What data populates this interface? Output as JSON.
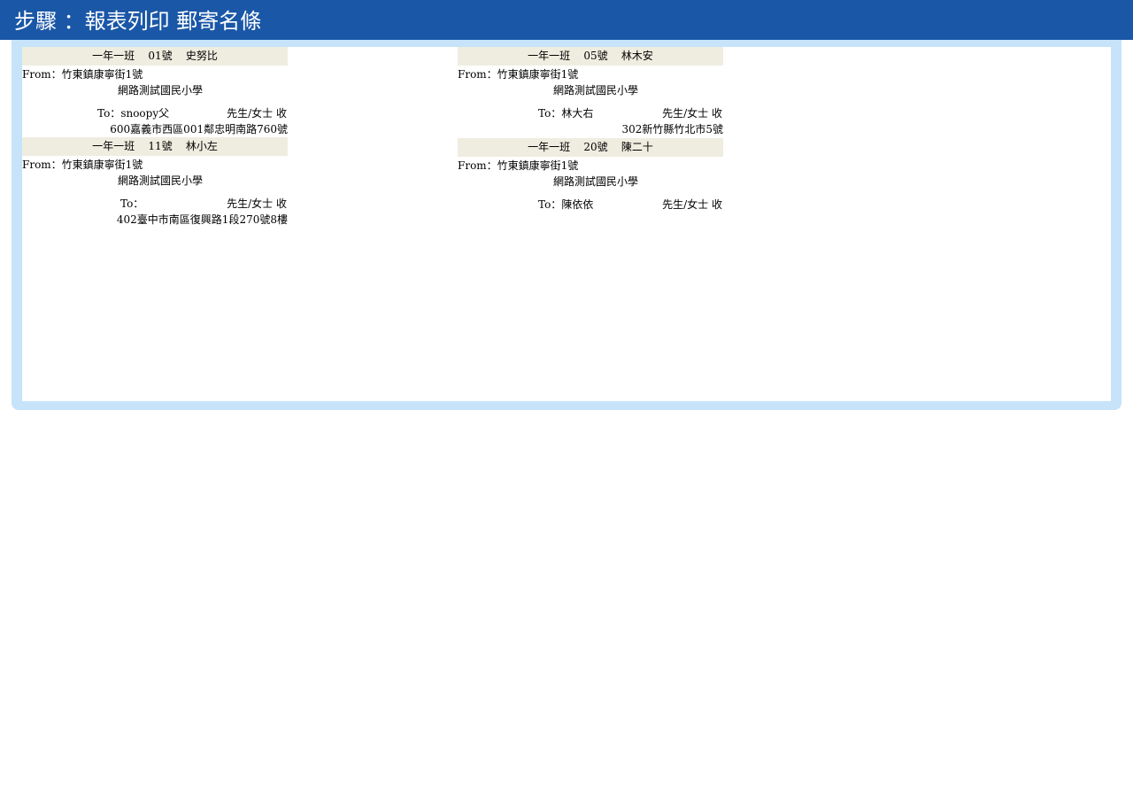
{
  "header": {
    "title": "步驟 ：報表列印  郵寄名條"
  },
  "labels": [
    {
      "class_name": "一年一班",
      "seat": "01號",
      "student": "史努比",
      "from_label": "From：",
      "from_address": "竹東鎮康寧街1號",
      "from_school": "網路測試國民小學",
      "to_label": "To：",
      "to_name": "snoopy父",
      "to_suffix": "先生/女士 收",
      "to_address": "600嘉義市西區001鄰忠明南路760號"
    },
    {
      "class_name": "一年一班",
      "seat": "05號",
      "student": "林木安",
      "from_label": "From：",
      "from_address": "竹東鎮康寧街1號",
      "from_school": "網路測試國民小學",
      "to_label": "To：",
      "to_name": "林大右",
      "to_suffix": "先生/女士 收",
      "to_address": "302新竹縣竹北市5號"
    },
    {
      "class_name": "一年一班",
      "seat": "11號",
      "student": "林小左",
      "from_label": "From：",
      "from_address": "竹東鎮康寧街1號",
      "from_school": "網路測試國民小學",
      "to_label": "To：",
      "to_name": "",
      "to_suffix": "先生/女士 收",
      "to_address": "402臺中市南區復興路1段270號8樓"
    },
    {
      "class_name": "一年一班",
      "seat": "20號",
      "student": "陳二十",
      "from_label": "From：",
      "from_address": "竹東鎮康寧街1號",
      "from_school": "網路測試國民小學",
      "to_label": "To：",
      "to_name": "陳依依",
      "to_suffix": "先生/女士 收",
      "to_address": ""
    }
  ],
  "colors": {
    "header_bg": "#1a57a7",
    "panel_border": "#c6e3fa",
    "label_header_bg": "#efede0"
  }
}
